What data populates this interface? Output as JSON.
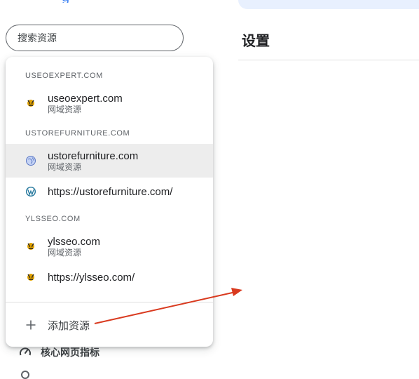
{
  "header": {
    "logo_fragment": "g"
  },
  "search": {
    "placeholder": "搜索资源"
  },
  "page": {
    "title": "设置"
  },
  "dropdown": {
    "groups": [
      {
        "header": "USEOEXPERT.COM",
        "items": [
          {
            "name": "useoexpert.com",
            "type": "网域资源",
            "icon": "tiger-favicon-icon"
          }
        ]
      },
      {
        "header": "USTOREFURNITURE.COM",
        "items": [
          {
            "name": "ustorefurniture.com",
            "type": "网域资源",
            "icon": "globe-icon",
            "selected": true
          },
          {
            "name": "https://ustorefurniture.com/",
            "icon": "wordpress-icon"
          }
        ]
      },
      {
        "header": "YLSSEO.COM",
        "items": [
          {
            "name": "ylsseo.com",
            "type": "网域资源",
            "icon": "tiger-favicon-icon"
          },
          {
            "name": "https://ylsseo.com/",
            "icon": "tiger-favicon-icon"
          }
        ]
      }
    ],
    "add_label": "添加资源"
  },
  "nav": {
    "core_web_vitals": "核心网页指标"
  },
  "colors": {
    "accent": "#4285f4",
    "selected_bg": "#ededed",
    "annotation_arrow": "#d93a1f"
  }
}
